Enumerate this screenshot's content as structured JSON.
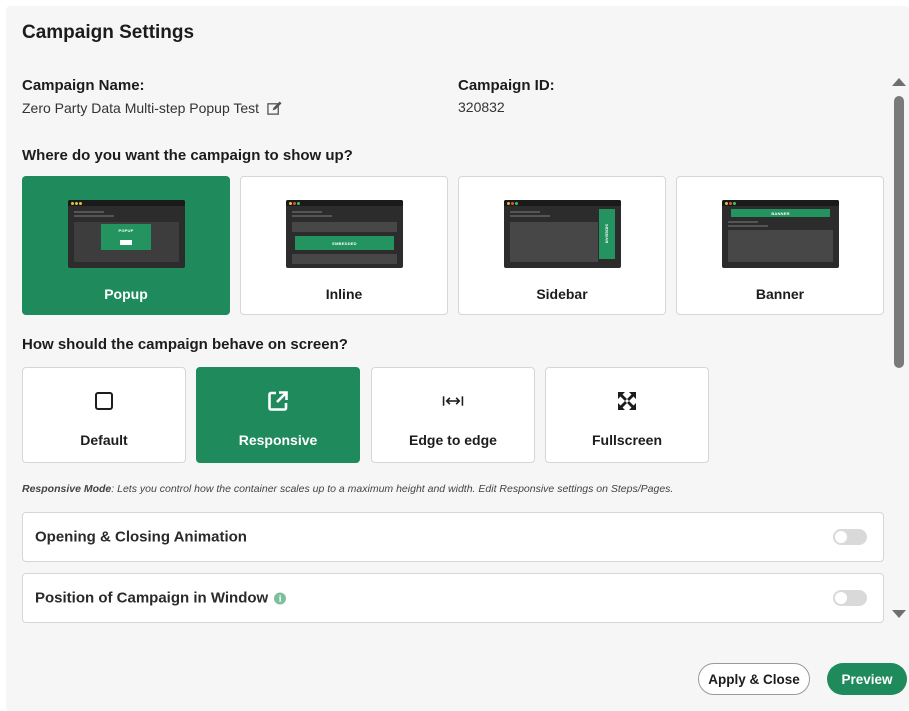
{
  "header": {
    "title": "Campaign Settings"
  },
  "campaign": {
    "name_label": "Campaign Name:",
    "name_value": "Zero Party Data Multi-step Popup Test",
    "id_label": "Campaign ID:",
    "id_value": "320832"
  },
  "placement": {
    "question": "Where do you want the campaign to show up?",
    "selected": "Popup",
    "options": [
      {
        "label": "Popup",
        "thumb_text": "POPUP"
      },
      {
        "label": "Inline",
        "thumb_text": "EMBEDDED"
      },
      {
        "label": "Sidebar",
        "thumb_text": "SIDEBAR"
      },
      {
        "label": "Banner",
        "thumb_text": "BANNER"
      }
    ]
  },
  "behavior": {
    "question": "How should the campaign behave on screen?",
    "selected": "Responsive",
    "options": [
      {
        "label": "Default",
        "icon": "square-icon"
      },
      {
        "label": "Responsive",
        "icon": "external-link-icon"
      },
      {
        "label": "Edge to edge",
        "icon": "edge-to-edge-icon"
      },
      {
        "label": "Fullscreen",
        "icon": "fullscreen-icon"
      }
    ],
    "help_bold": "Responsive Mode",
    "help_text": ": Lets you control how the container scales up to a maximum height and width. Edit Responsive settings on Steps/Pages."
  },
  "toggles": [
    {
      "label": "Opening & Closing Animation",
      "enabled": false
    },
    {
      "label": "Position of Campaign in Window",
      "enabled": false,
      "info_icon": "info-icon",
      "info_glyph": "i"
    }
  ],
  "footer": {
    "apply_label": "Apply & Close",
    "preview_label": "Preview"
  },
  "colors": {
    "accent": "#1f8a5c",
    "panel": "#f6f6f6",
    "card_border": "#d6d6d6"
  }
}
